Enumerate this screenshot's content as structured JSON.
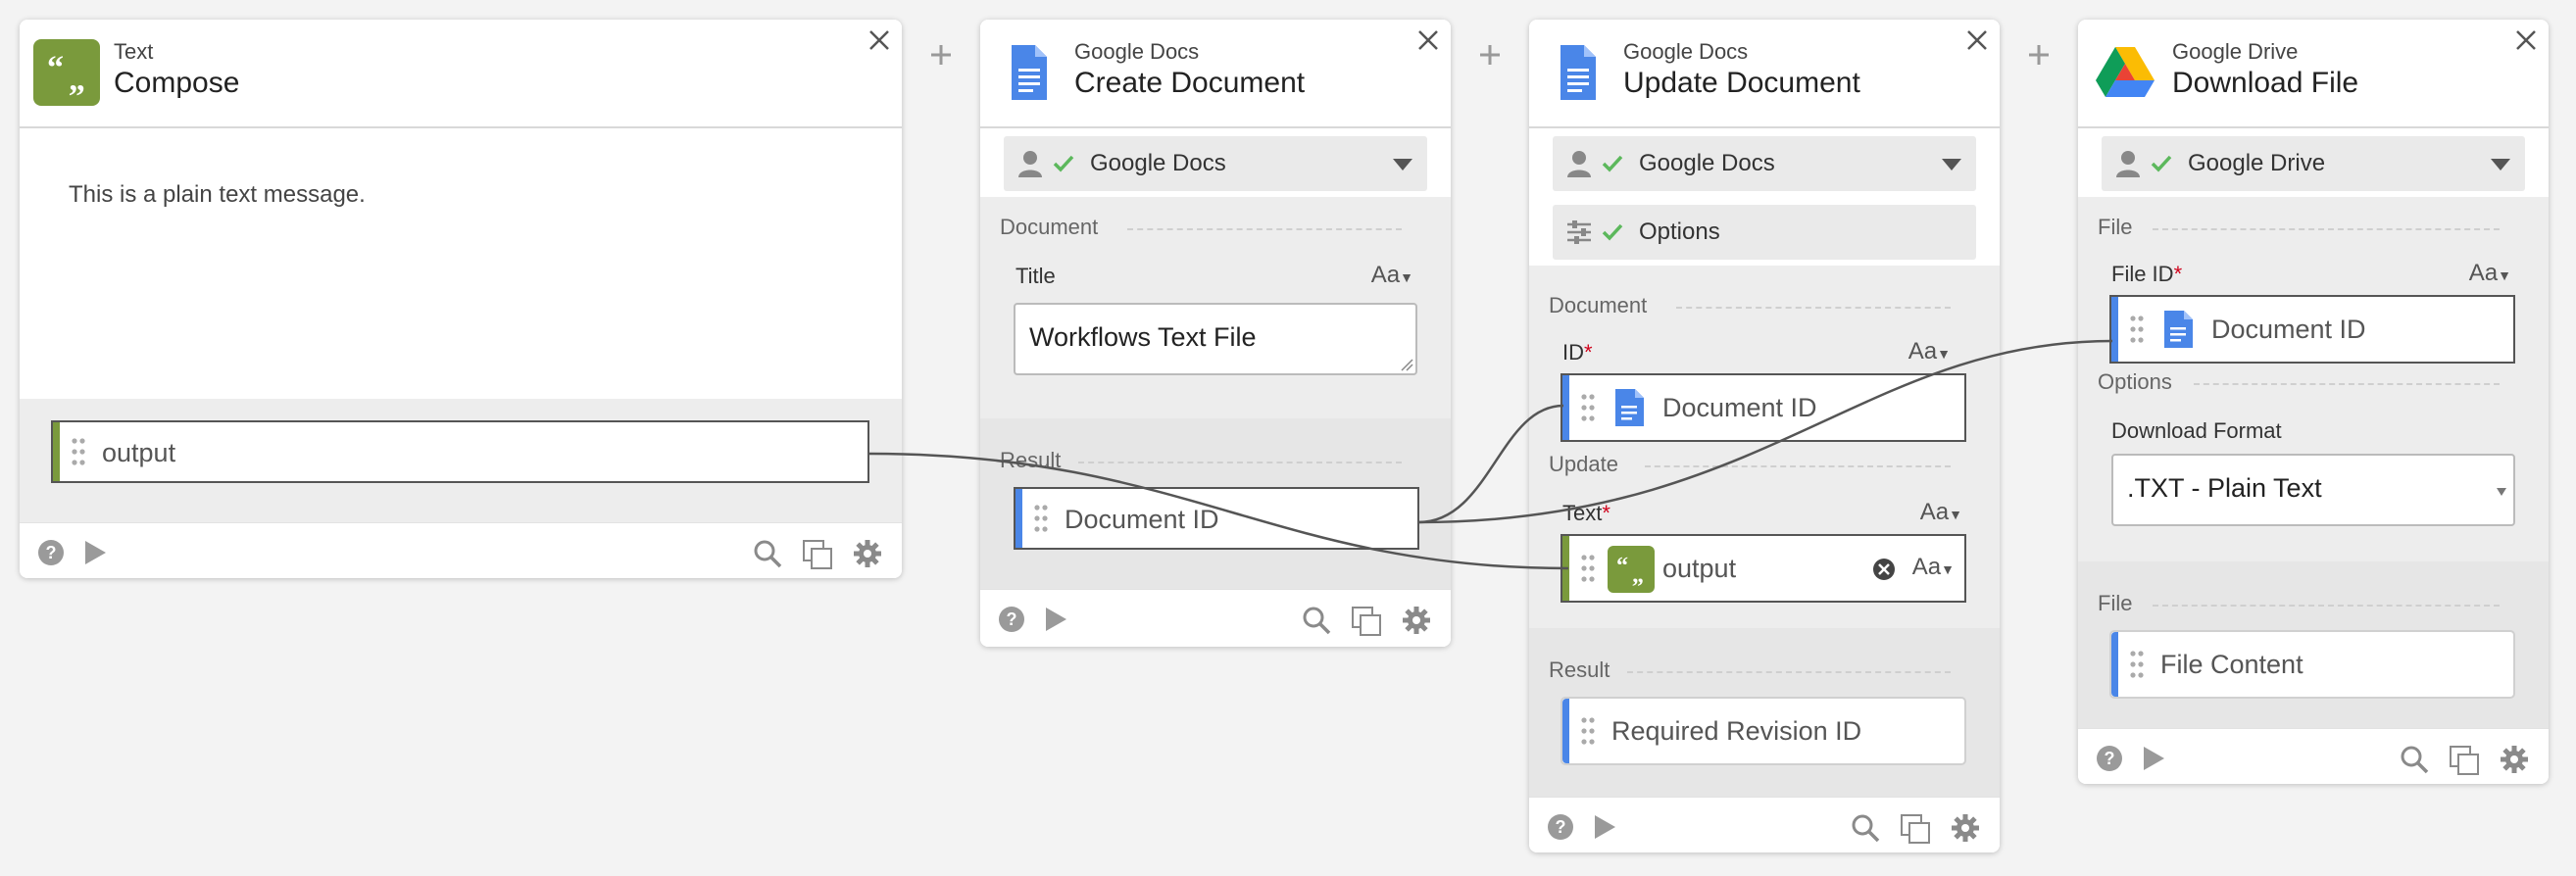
{
  "cards": {
    "compose": {
      "service": "Text",
      "action": "Compose",
      "body_text": "This is a plain text message.",
      "output_label": "output"
    },
    "create_doc": {
      "service": "Google Docs",
      "action": "Create Document",
      "auth_label": "Google Docs",
      "section_document": "Document",
      "title_label": "Title",
      "title_value": "Workflows Text File",
      "type_toggle": "Aa",
      "section_result": "Result",
      "result_label": "Document ID"
    },
    "update_doc": {
      "service": "Google Docs",
      "action": "Update Document",
      "auth_label": "Google Docs",
      "options_label": "Options",
      "section_document": "Document",
      "id_label": "ID",
      "id_value": "Document ID",
      "section_update": "Update",
      "text_label": "Text",
      "text_value": "output",
      "type_toggle": "Aa",
      "section_result": "Result",
      "result_label": "Required Revision ID"
    },
    "download_file": {
      "service": "Google Drive",
      "action": "Download File",
      "auth_label": "Google Drive",
      "section_file": "File",
      "file_id_label": "File ID",
      "file_id_value": "Document ID",
      "type_toggle": "Aa",
      "section_options": "Options",
      "format_label": "Download Format",
      "format_value": ".TXT - Plain Text",
      "section_file_out": "File",
      "result_label": "File Content"
    }
  },
  "required_marker": "*",
  "colors": {
    "text_green": "#7a9a3c",
    "docs_blue": "#4a86e8",
    "check_green": "#5cb85c"
  },
  "icons": [
    "quote-icon",
    "google-docs-icon",
    "google-drive-icon",
    "close-icon",
    "plus-icon",
    "person-icon",
    "check-icon",
    "chevron-down-icon",
    "sliders-icon",
    "drag-handle-icon",
    "help-icon",
    "play-icon",
    "search-icon",
    "copy-icon",
    "gear-icon",
    "clear-icon",
    "resize-icon"
  ]
}
